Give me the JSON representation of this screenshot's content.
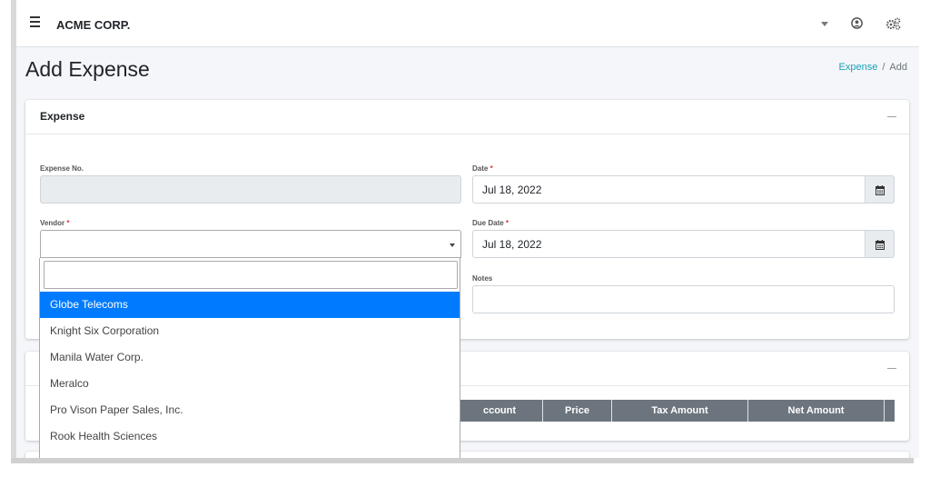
{
  "navbar": {
    "brand": "ACME CORP."
  },
  "page": {
    "title": "Add Expense",
    "breadcrumb": {
      "link": "Expense",
      "current": "Add"
    }
  },
  "expense_card": {
    "title": "Expense",
    "fields": {
      "expense_no_label": "Expense No.",
      "expense_no_value": "",
      "date_label": "Date",
      "date_value": "Jul 18, 2022",
      "vendor_label": "Vendor",
      "vendor_value": "",
      "due_date_label": "Due Date",
      "due_date_value": "Jul 18, 2022",
      "notes_label": "Notes",
      "notes_value": "",
      "required_mark": "*"
    }
  },
  "items_card": {
    "columns": [
      "ccount",
      "Price",
      "Tax Amount",
      "Net Amount"
    ]
  },
  "vendor_dropdown": {
    "search_value": "",
    "options": [
      "Globe Telecoms",
      "Knight Six Corporation",
      "Manila Water Corp.",
      "Meralco",
      "Pro Vison Paper Sales, Inc.",
      "Rook Health Sciences"
    ],
    "highlighted_index": 0
  },
  "colors": {
    "accent": "#007bff",
    "link": "#17a2b8",
    "required": "#dc3545",
    "table_header": "#6c757d"
  }
}
